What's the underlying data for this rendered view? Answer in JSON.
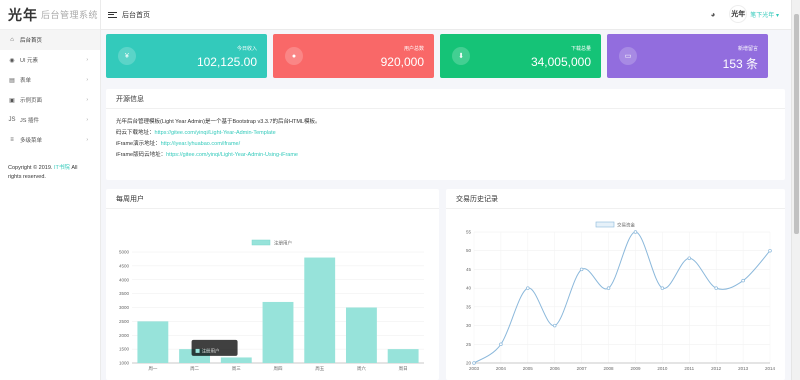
{
  "brand": {
    "logo_char1": "光",
    "logo_char2": "年",
    "system_name": "后台管理系统"
  },
  "sidebar": {
    "items": [
      {
        "label": "后台首页",
        "icon": "home-icon",
        "glyph": "⌂",
        "active": true,
        "has_sub": false
      },
      {
        "label": "UI 元素",
        "icon": "palette-icon",
        "glyph": "◉",
        "active": false,
        "has_sub": true
      },
      {
        "label": "表单",
        "icon": "form-icon",
        "glyph": "▤",
        "active": false,
        "has_sub": true
      },
      {
        "label": "示例页面",
        "icon": "file-icon",
        "glyph": "▣",
        "active": false,
        "has_sub": true
      },
      {
        "label": "JS 插件",
        "icon": "language-js-icon",
        "glyph": "JS",
        "active": false,
        "has_sub": true
      },
      {
        "label": "多级菜单",
        "icon": "menu-icon",
        "glyph": "≡",
        "active": false,
        "has_sub": true
      }
    ]
  },
  "copyright": {
    "prefix": "Copyright © 2019.",
    "link": "IT书院",
    "suffix": "All rights reserved."
  },
  "topbar": {
    "title": "后台首页",
    "username": "笔下光年",
    "palette_glyph": "◕",
    "avatar_char": "光年"
  },
  "stats": [
    {
      "label": "今日收入",
      "value": "102,125.00",
      "color": "#33cabb",
      "icon": "currency-cny-icon",
      "glyph": "¥"
    },
    {
      "label": "用户总数",
      "value": "920,000",
      "color": "#f96868",
      "icon": "account-icon",
      "glyph": "●"
    },
    {
      "label": "下载总量",
      "value": "34,005,000",
      "color": "#15c377",
      "icon": "arrow-down-icon",
      "glyph": "⬇"
    },
    {
      "label": "新增留言",
      "value": "153 条",
      "color": "#926dde",
      "icon": "comment-icon",
      "glyph": "▭"
    }
  ],
  "open_info": {
    "title": "开源信息",
    "line1": "光年后台管理模板(Light Year Admin)是一个基于Bootstrap v3.3.7的后台HTML模板。",
    "line2_label": "码云下载地址：",
    "line2_link": "https://gitee.com/yinqi/Light-Year-Admin-Template",
    "line3_label": "iFrame演示地址：",
    "line3_link": "http://iyear.lyhuabao.com/iframe/",
    "line4_label": "iFrame版码云地址：",
    "line4_link": "https://gitee.com/yinqi/Light-Year-Admin-Using-iFrame"
  },
  "bar_panel": {
    "title": "每周用户",
    "tooltip": "注册用户"
  },
  "line_panel": {
    "title": "交易历史记录"
  },
  "chart_data": [
    {
      "type": "bar",
      "title": "每周用户",
      "legend": "注册用户",
      "categories": [
        "周一",
        "周二",
        "周三",
        "周四",
        "周五",
        "周六",
        "周日"
      ],
      "values": [
        2500,
        1500,
        1200,
        3200,
        4800,
        3000,
        1500
      ],
      "ylim": [
        1000,
        5000
      ],
      "yticks": [
        1000,
        1500,
        2000,
        2500,
        3000,
        3500,
        4000,
        4500,
        5000
      ],
      "color": "#97e3da"
    },
    {
      "type": "line",
      "title": "交易历史记录",
      "legend": "交易资金",
      "x": [
        "2003",
        "2004",
        "2005",
        "2006",
        "2007",
        "2008",
        "2009",
        "2010",
        "2011",
        "2012",
        "2013",
        "2014"
      ],
      "values": [
        20,
        25,
        40,
        30,
        45,
        40,
        55,
        40,
        48,
        40,
        42,
        50
      ],
      "ylim": [
        20,
        55
      ],
      "yticks": [
        20,
        25,
        30,
        35,
        40,
        45,
        50,
        55
      ],
      "color": "#8bb8db"
    }
  ]
}
